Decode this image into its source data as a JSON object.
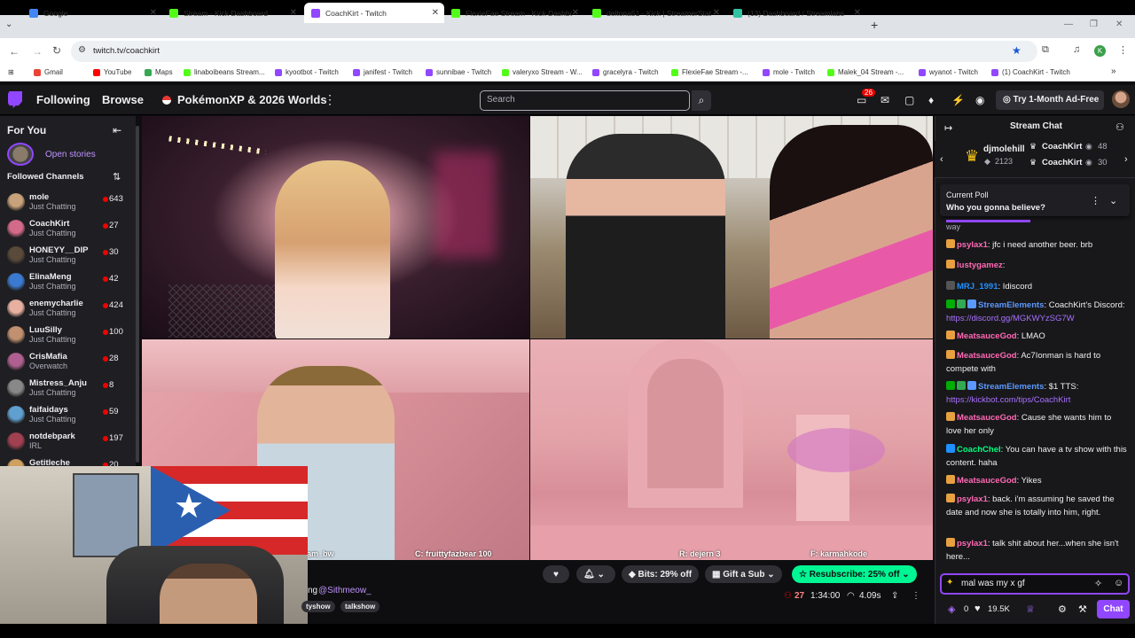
{
  "browser": {
    "tabs": [
      {
        "label": "Google",
        "color": "#4285f4",
        "active": false
      },
      {
        "label": "Stream - Kick Dashboard",
        "color": "#53fc18",
        "active": false
      },
      {
        "label": "CoachKirt - Twitch",
        "color": "#9146ff",
        "active": true
      },
      {
        "label": "FlexieFae Stream - Kick Dashboar",
        "color": "#53fc18",
        "active": false
      },
      {
        "label": "deltona51 - Kick | StreamerStat",
        "color": "#53fc18",
        "active": false
      },
      {
        "label": "(13) Dashboard / Streamlabs",
        "color": "#31c3a2",
        "active": false
      }
    ],
    "url": "twitch.tv/coachkirt",
    "bookmarks": [
      {
        "label": "Gmail",
        "color": "#ea4335"
      },
      {
        "label": "YouTube",
        "color": "#ff0000"
      },
      {
        "label": "Maps",
        "color": "#34a853"
      },
      {
        "label": "linaboibeans Stream...",
        "color": "#53fc18"
      },
      {
        "label": "kyootbot - Twitch",
        "color": "#9146ff"
      },
      {
        "label": "janifest - Twitch",
        "color": "#9146ff"
      },
      {
        "label": "sunnibae - Twitch",
        "color": "#9146ff"
      },
      {
        "label": "valeryxo Stream - W...",
        "color": "#53fc18"
      },
      {
        "label": "gracelyra - Twitch",
        "color": "#9146ff"
      },
      {
        "label": "FlexieFae Stream -...",
        "color": "#53fc18"
      },
      {
        "label": "mole - Twitch",
        "color": "#9146ff"
      },
      {
        "label": "Malek_04 Stream -...",
        "color": "#53fc18"
      },
      {
        "label": "wyanot - Twitch",
        "color": "#9146ff"
      },
      {
        "label": "(1) CoachKirt - Twitch",
        "color": "#9146ff"
      }
    ],
    "profile_letter": "K"
  },
  "twitch_nav": {
    "following": "Following",
    "browse": "Browse",
    "pokemon": "PokémonXP & 2026 Worlds",
    "search_placeholder": "Search",
    "notif_count": "26",
    "try_label": "Try 1-Month Ad-Free"
  },
  "sidebar": {
    "title": "For You",
    "stories": "Open stories",
    "followed_title": "Followed Channels",
    "channels": [
      {
        "name": "mole",
        "game": "Just Chatting",
        "viewers": "643",
        "color": "#c8a27a"
      },
      {
        "name": "CoachKirt",
        "game": "Just Chatting",
        "viewers": "27",
        "color": "#d46a8a"
      },
      {
        "name": "HONEYY__DIP",
        "game": "Just Chatting",
        "viewers": "30",
        "color": "#5a4a3a"
      },
      {
        "name": "ElinaMeng",
        "game": "Just Chatting",
        "viewers": "42",
        "color": "#3a7ad0"
      },
      {
        "name": "enemycharlie",
        "game": "Just Chatting",
        "viewers": "424",
        "color": "#e8b0a0"
      },
      {
        "name": "LuuSilly",
        "game": "Just Chatting",
        "viewers": "100",
        "color": "#c09070"
      },
      {
        "name": "CrisMafia",
        "game": "Overwatch",
        "viewers": "28",
        "color": "#b06090"
      },
      {
        "name": "Mistress_Anju",
        "game": "Just Chatting",
        "viewers": "8",
        "color": "#888888"
      },
      {
        "name": "faifaidays",
        "game": "Just Chatting",
        "viewers": "59",
        "color": "#60a0d0"
      },
      {
        "name": "notdebpark",
        "game": "IRL",
        "viewers": "197",
        "color": "#a04050"
      },
      {
        "name": "Getitleche",
        "game": "",
        "viewers": "20",
        "color": "#d0a060"
      }
    ]
  },
  "video": {
    "cap_bottom_left_partial": "tam_bw",
    "cap_bottom_left": "C: fruittyfazbear 100",
    "cap_bottom_right_a": "R: dejern 3",
    "cap_bottom_right_b": "F: karmahkode"
  },
  "below_player": {
    "bits": "Bits: 29% off",
    "gift": "Gift a Sub",
    "resub": "Resubscribe: 25% off",
    "viewers": "27",
    "uptime": "1:34:00",
    "latency": "4.09s",
    "title_partial": "ng",
    "mention": "@Sithmeow_",
    "tags": [
      "tyshow",
      "talkshow"
    ]
  },
  "chat": {
    "header": "Stream Chat",
    "hype_top_user": "djmolehill",
    "hype_top_value": "2123",
    "leader_1_name": "CoachKirt",
    "leader_1_value": "48",
    "leader_2_name": "CoachKirt",
    "leader_2_value": "30",
    "poll_title": "Current Poll",
    "poll_question": "Who you gonna believe?",
    "messages": [
      {
        "user": "psylax1",
        "color": "#ff69b4",
        "text": ": jfc i need another beer. brb"
      },
      {
        "user": "lustygamez",
        "color": "#ff69b4",
        "text": ":"
      },
      {
        "user": "MRJ_1991",
        "color": "#1e90ff",
        "text": ": Idiscord"
      },
      {
        "user": "StreamElements",
        "color": "#5b99ff",
        "text": ": CoachKirt's Discord: ",
        "link": "https://discord.gg/MGKWYzSG7W"
      },
      {
        "user": "MeatsauceGod",
        "color": "#ff69b4",
        "text": ": LMAO"
      },
      {
        "user": "MeatsauceGod",
        "color": "#ff69b4",
        "text": ": Ac7Ionman is hard to compete with"
      },
      {
        "user": "StreamElements",
        "color": "#5b99ff",
        "text": ": $1 TTS: ",
        "link": "https://kickbot.com/tips/CoachKirt"
      },
      {
        "user": "MeatsauceGod",
        "color": "#ff69b4",
        "text": ": Cause she wants him to love her only"
      },
      {
        "user": "CoachChel",
        "color": "#00ff7f",
        "text": ": You can have a tv show with this content. haha"
      },
      {
        "user": "MeatsauceGod",
        "color": "#ff69b4",
        "text": ": Yikes"
      },
      {
        "user": "psylax1",
        "color": "#ff69b4",
        "text": ": back. i'm assuming he saved the date and now she is totally into him, right."
      },
      {
        "user": "psylax1",
        "color": "#ff69b4",
        "text": ": talk shit about her...when she isn't here..."
      }
    ],
    "input_value": "mal was my x gf",
    "points": "0",
    "hearts": "19.5K",
    "chat_button": "Chat"
  }
}
